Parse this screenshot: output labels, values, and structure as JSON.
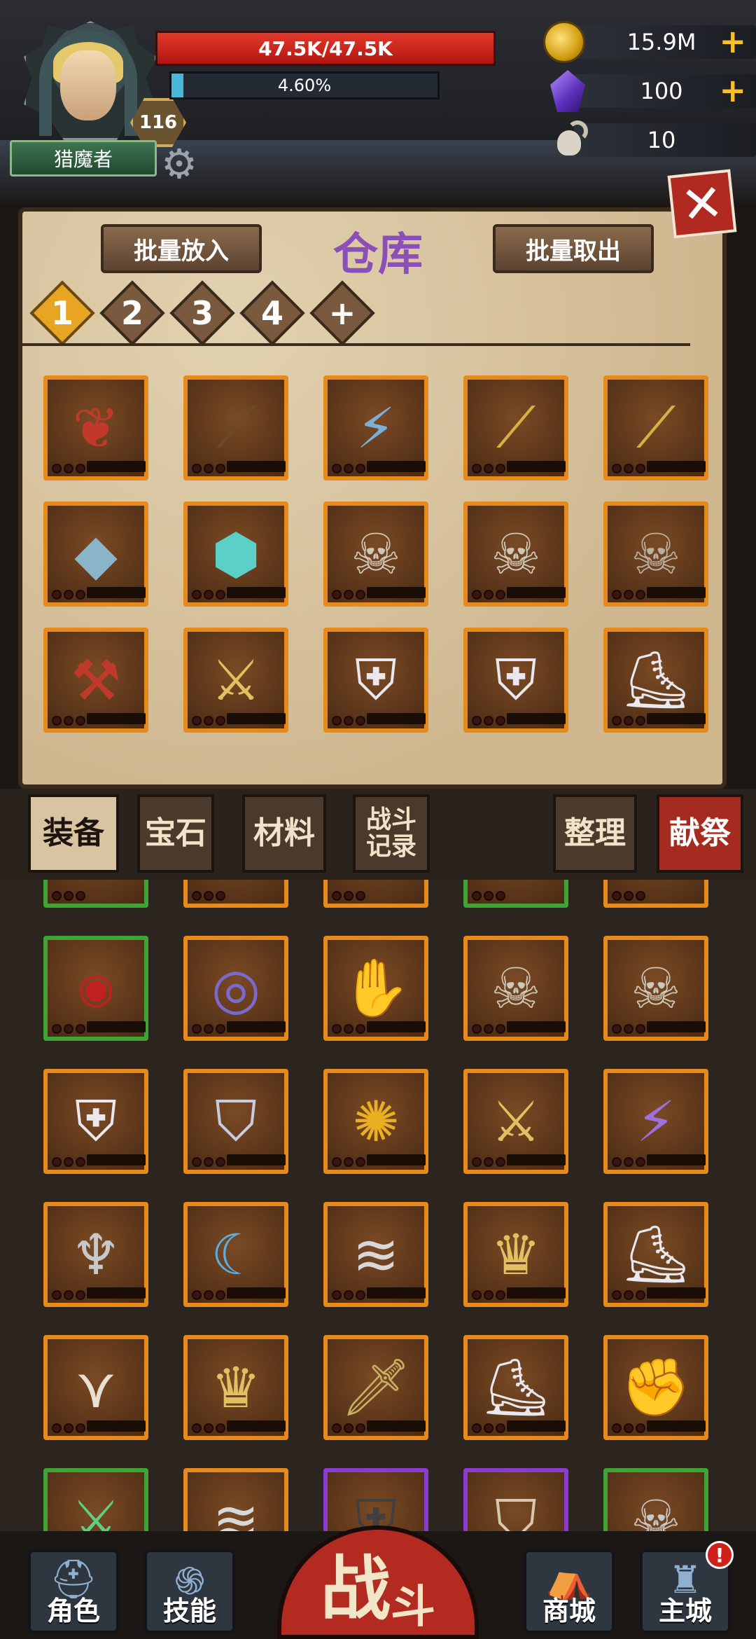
{
  "player": {
    "class_name": "猎魔者",
    "level": "116",
    "hp_text": "47.5K/47.5K",
    "exp_text": "4.60%",
    "exp_fraction": 0.046
  },
  "resources": {
    "gold": "15.9M",
    "crystals": "100",
    "skulls": "10"
  },
  "warehouse": {
    "title": "仓库",
    "bulk_put_label": "批量放入",
    "bulk_take_label": "批量取出",
    "tabs": [
      "1",
      "2",
      "3",
      "4",
      "+"
    ],
    "active_tab": "1"
  },
  "bag_tabs": {
    "equipment": "装备",
    "gems": "宝石",
    "materials": "材料",
    "battle_log_line1": "战斗",
    "battle_log_line2": "记录",
    "sort": "整理",
    "sacrifice": "献祭"
  },
  "nav": {
    "character": "角色",
    "skills": "技能",
    "battle_big": "战",
    "battle_small": "斗",
    "shop": "商城",
    "main_city": "主城",
    "alert": "!"
  },
  "colors": {
    "hp": "#c9241a",
    "exp": "#4ab7d6",
    "slot_orange": "#e78a1c",
    "slot_green": "#3fa336",
    "slot_purple": "#8c3bd0",
    "title_purple": "#8b4fb8",
    "gold_plus": "#f5c131"
  }
}
